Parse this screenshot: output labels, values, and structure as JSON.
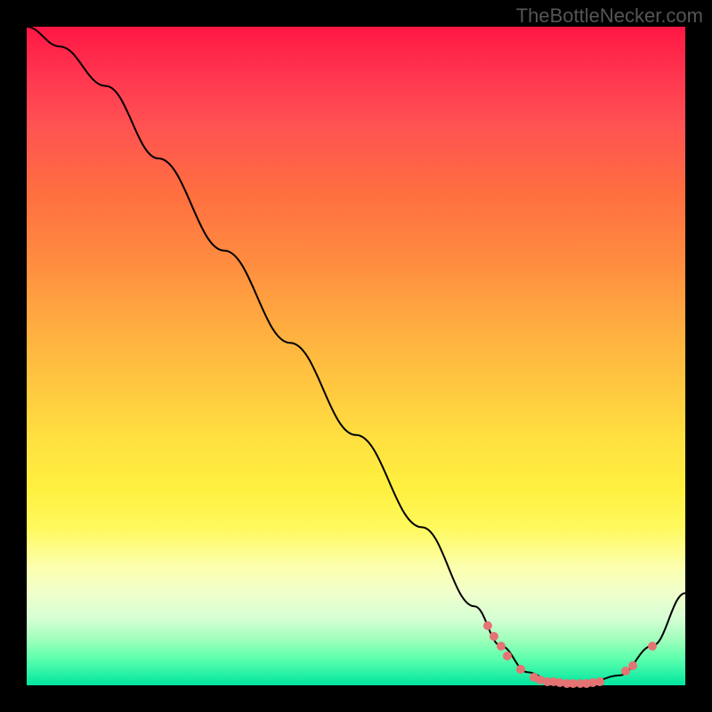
{
  "watermark": "TheBottleNecker.com",
  "chart_data": {
    "type": "line",
    "title": "",
    "xlabel": "",
    "ylabel": "",
    "xlim": [
      0,
      100
    ],
    "ylim": [
      0,
      100
    ],
    "curve": [
      {
        "x": 0,
        "y": 100
      },
      {
        "x": 5,
        "y": 97
      },
      {
        "x": 12,
        "y": 91
      },
      {
        "x": 20,
        "y": 80
      },
      {
        "x": 30,
        "y": 66
      },
      {
        "x": 40,
        "y": 52
      },
      {
        "x": 50,
        "y": 38
      },
      {
        "x": 60,
        "y": 24
      },
      {
        "x": 68,
        "y": 12
      },
      {
        "x": 72,
        "y": 6
      },
      {
        "x": 76,
        "y": 2
      },
      {
        "x": 80,
        "y": 0.5
      },
      {
        "x": 85,
        "y": 0.3
      },
      {
        "x": 90,
        "y": 1.5
      },
      {
        "x": 95,
        "y": 6
      },
      {
        "x": 100,
        "y": 14
      }
    ],
    "points": [
      {
        "x": 70,
        "y": 9
      },
      {
        "x": 71,
        "y": 7.5
      },
      {
        "x": 72,
        "y": 6
      },
      {
        "x": 73,
        "y": 4.5
      },
      {
        "x": 75,
        "y": 2.5
      },
      {
        "x": 77,
        "y": 1.2
      },
      {
        "x": 78,
        "y": 0.8
      },
      {
        "x": 79,
        "y": 0.6
      },
      {
        "x": 80,
        "y": 0.5
      },
      {
        "x": 81,
        "y": 0.4
      },
      {
        "x": 82,
        "y": 0.3
      },
      {
        "x": 83,
        "y": 0.3
      },
      {
        "x": 84,
        "y": 0.3
      },
      {
        "x": 85,
        "y": 0.3
      },
      {
        "x": 86,
        "y": 0.4
      },
      {
        "x": 87,
        "y": 0.6
      },
      {
        "x": 91,
        "y": 2.2
      },
      {
        "x": 92,
        "y": 3
      },
      {
        "x": 95,
        "y": 6
      }
    ]
  }
}
